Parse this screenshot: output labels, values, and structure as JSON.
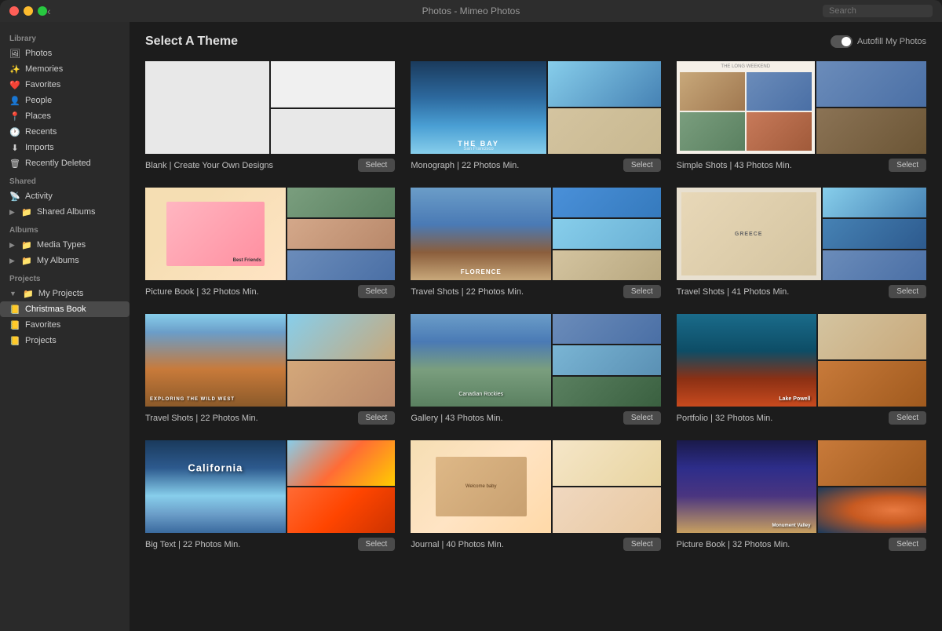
{
  "titlebar": {
    "title": "Photos - Mimeo Photos",
    "search_placeholder": "Search"
  },
  "sidebar": {
    "library_label": "Library",
    "library_items": [
      {
        "id": "photos",
        "label": "Photos",
        "icon": "🖼"
      },
      {
        "id": "memories",
        "label": "Memories",
        "icon": "✨"
      },
      {
        "id": "favorites",
        "label": "Favorites",
        "icon": "❤️"
      },
      {
        "id": "people",
        "label": "People",
        "icon": "👤"
      },
      {
        "id": "places",
        "label": "Places",
        "icon": "📍"
      },
      {
        "id": "recents",
        "label": "Recents",
        "icon": "🕐"
      },
      {
        "id": "imports",
        "label": "Imports",
        "icon": "⬇"
      },
      {
        "id": "recently-deleted",
        "label": "Recently Deleted",
        "icon": "🗑"
      }
    ],
    "shared_label": "Shared",
    "shared_items": [
      {
        "id": "activity",
        "label": "Activity",
        "icon": "📡"
      },
      {
        "id": "shared-albums",
        "label": "Shared Albums",
        "icon": "📁"
      }
    ],
    "albums_label": "Albums",
    "albums_items": [
      {
        "id": "media-types",
        "label": "Media Types",
        "icon": "📁"
      },
      {
        "id": "my-albums",
        "label": "My Albums",
        "icon": "📁"
      }
    ],
    "projects_label": "Projects",
    "projects_items": [
      {
        "id": "my-projects",
        "label": "My Projects",
        "icon": "📁"
      },
      {
        "id": "christmas-book",
        "label": "Christmas Book",
        "icon": "📒",
        "active": true
      },
      {
        "id": "favorites-proj",
        "label": "Favorites",
        "icon": "📒"
      },
      {
        "id": "projects",
        "label": "Projects",
        "icon": "📒"
      }
    ]
  },
  "main": {
    "title": "Select A Theme",
    "autofill_label": "Autofill My Photos",
    "themes": [
      {
        "id": "blank",
        "label": "Blank | Create Your Own Designs",
        "select_label": "Select",
        "layout": "blank"
      },
      {
        "id": "monograph",
        "label": "Monograph | 22 Photos Min.",
        "select_label": "Select",
        "layout": "monograph"
      },
      {
        "id": "simple-shots",
        "label": "Simple Shots | 43 Photos Min.",
        "select_label": "Select",
        "layout": "simple-shots"
      },
      {
        "id": "picture-book",
        "label": "Picture Book | 32 Photos Min.",
        "select_label": "Select",
        "layout": "picture-book"
      },
      {
        "id": "travel-shots-22",
        "label": "Travel Shots | 22 Photos Min.",
        "select_label": "Select",
        "layout": "travel-shots-22"
      },
      {
        "id": "travel-shots-41",
        "label": "Travel Shots | 41 Photos Min.",
        "select_label": "Select",
        "layout": "travel-shots-41"
      },
      {
        "id": "travel-shots-22b",
        "label": "Travel Shots | 22 Photos Min.",
        "select_label": "Select",
        "layout": "travel-shots-22b"
      },
      {
        "id": "gallery",
        "label": "Gallery | 43 Photos Min.",
        "select_label": "Select",
        "layout": "gallery"
      },
      {
        "id": "portfolio",
        "label": "Portfolio | 32 Photos Min.",
        "select_label": "Select",
        "layout": "portfolio"
      },
      {
        "id": "big-text",
        "label": "Big Text | 22 Photos Min.",
        "select_label": "Select",
        "layout": "big-text"
      },
      {
        "id": "journal",
        "label": "Journal | 40 Photos Min.",
        "select_label": "Select",
        "layout": "journal"
      },
      {
        "id": "picture-book2",
        "label": "Picture Book | 32 Photos Min.",
        "select_label": "Select",
        "layout": "picture-book2"
      }
    ]
  }
}
